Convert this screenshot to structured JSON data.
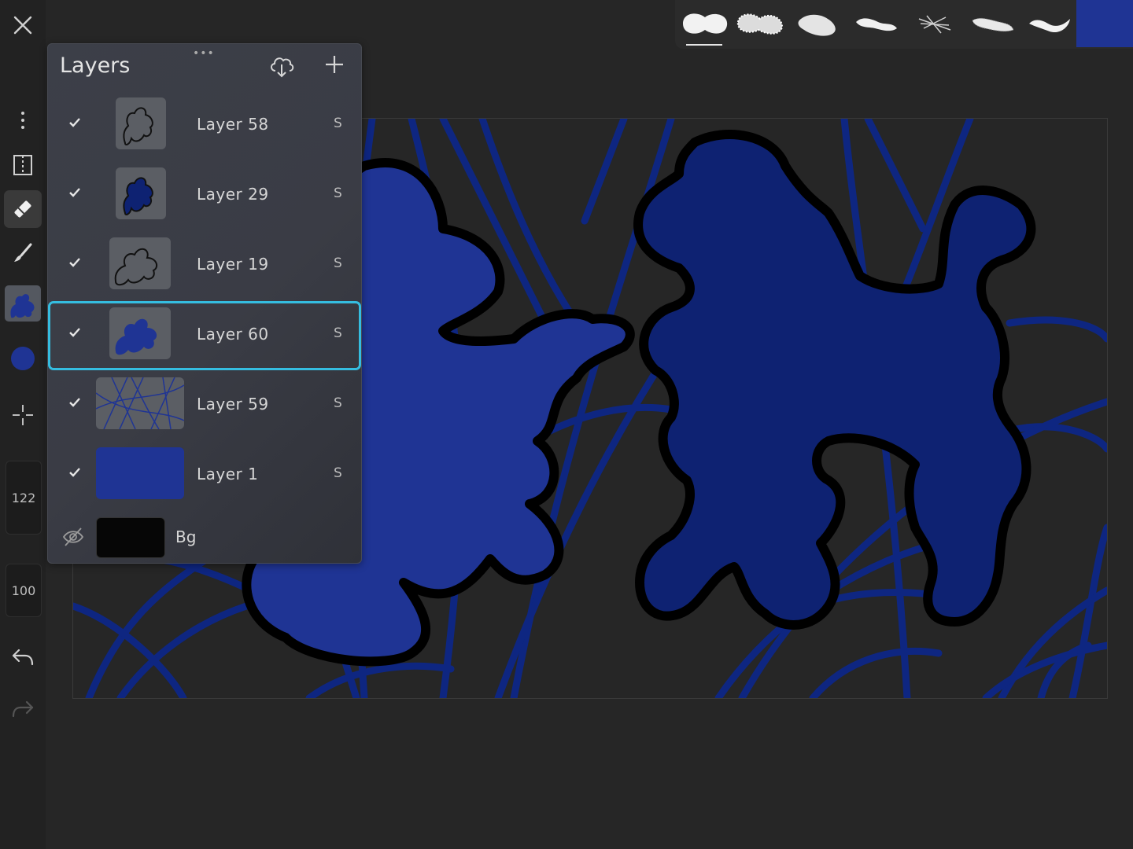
{
  "app": {
    "close_icon": "close-icon"
  },
  "sidebar": {
    "brush_size": "122",
    "opacity": "100",
    "tools": [
      "more-icon",
      "reference-icon",
      "eraser-icon",
      "brush-icon",
      "layer-thumb",
      "color-dot",
      "transform-icon",
      "undo-icon",
      "redo-icon"
    ]
  },
  "brushes": {
    "selected_index": 0,
    "count": 7,
    "current_color": "#1f3494"
  },
  "layers_panel": {
    "title": "Layers",
    "grip": "•••",
    "layers": [
      {
        "name": "Layer 58",
        "blend": "S",
        "visible": true,
        "selected": false
      },
      {
        "name": "Layer 29",
        "blend": "S",
        "visible": true,
        "selected": false
      },
      {
        "name": "Layer 19",
        "blend": "S",
        "visible": true,
        "selected": false
      },
      {
        "name": "Layer 60",
        "blend": "S",
        "visible": true,
        "selected": true
      },
      {
        "name": "Layer 59",
        "blend": "S",
        "visible": true,
        "selected": false
      },
      {
        "name": "Layer 1",
        "blend": "S",
        "visible": true,
        "selected": false
      }
    ],
    "background": {
      "name": "Bg",
      "visible": false
    }
  },
  "colors": {
    "accent_selection": "#35bde0",
    "poodle_front": "#1f3494",
    "poodle_back": "#0e2272",
    "scribble": "#0d2686"
  }
}
